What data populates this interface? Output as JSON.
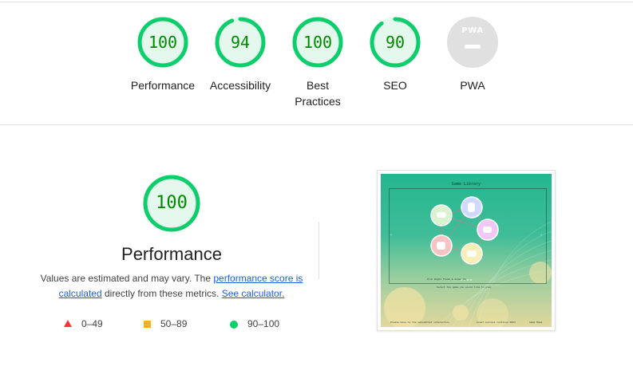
{
  "categories": [
    {
      "label": "Performance",
      "score": "100",
      "value": 100
    },
    {
      "label": "Accessibility",
      "score": "94",
      "value": 94
    },
    {
      "label": "Best Practices",
      "score": "100",
      "value": 100
    },
    {
      "label": "SEO",
      "score": "90",
      "value": 90
    },
    {
      "label": "PWA",
      "score": "",
      "value": null,
      "badge": "PWA"
    }
  ],
  "performance": {
    "score": "100",
    "value": 100,
    "title": "Performance",
    "desc_before": "Values are estimated and may vary. The ",
    "link_score": "performance score is calculated",
    "desc_middle": " directly from these metrics. ",
    "link_calc": "See calculator."
  },
  "legend": [
    {
      "range": "0–49",
      "color": "#ff3333",
      "shape": "triangle"
    },
    {
      "range": "50–89",
      "color": "#ffaa33",
      "shape": "square"
    },
    {
      "range": "90–100",
      "color": "#0cce6b",
      "shape": "circle"
    }
  ],
  "screenshot": {
    "title": "Game Library",
    "caption": "Pick Right Thumb & Index Up",
    "subcaption": "Select the game you would like to play",
    "footer_left": "Please move to the webcamthat interaction",
    "footer_mid": "Great success continue 2023",
    "footer_right": "Game Home"
  },
  "colors": {
    "pass": "#0cce6b",
    "pass_text": "#008800",
    "pass_bg": "#e5f8ed",
    "average": "#ffaa33",
    "fail": "#ff3333",
    "link": "#1a5fe0",
    "pwa_grey": "#e0e0e0"
  }
}
